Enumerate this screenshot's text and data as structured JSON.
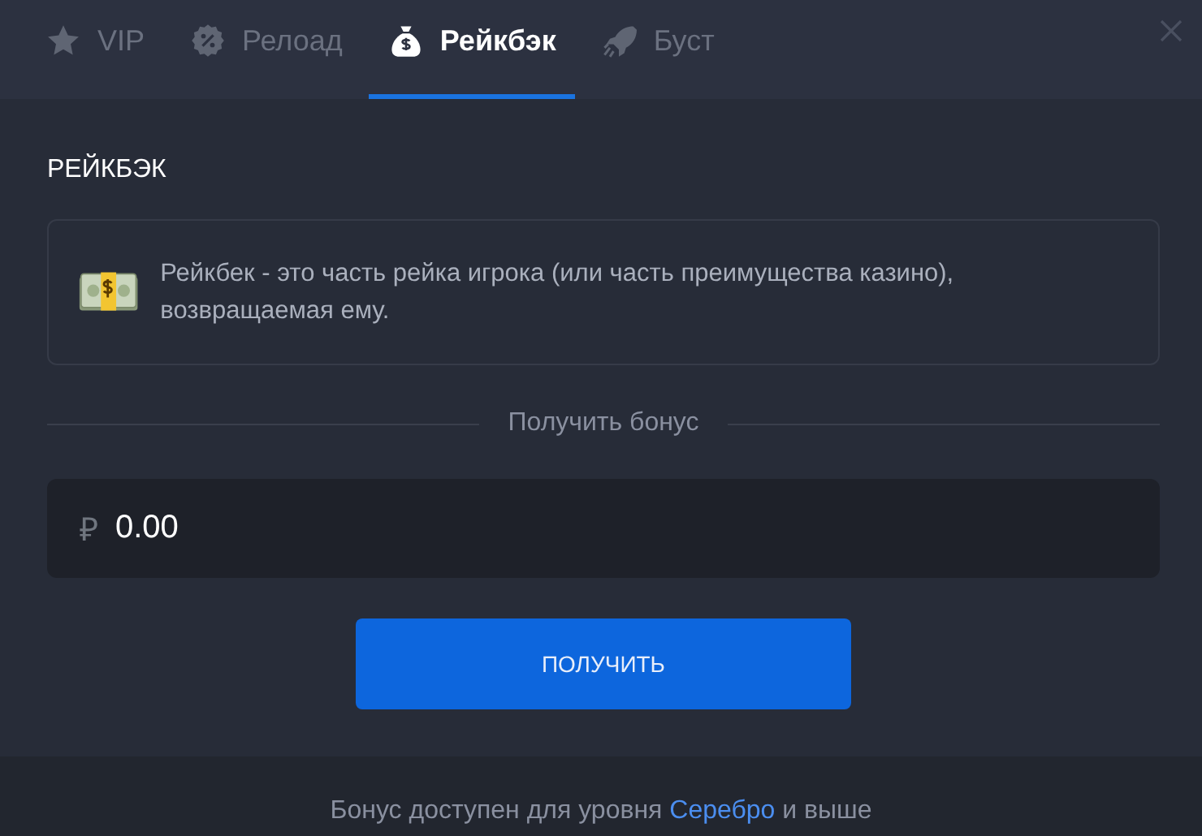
{
  "tabs": [
    {
      "label": "VIP",
      "kind": "star",
      "selected": false
    },
    {
      "label": "Релоад",
      "kind": "percent",
      "selected": false
    },
    {
      "label": "Рейкбэк",
      "kind": "moneybag",
      "selected": true
    },
    {
      "label": "Буст",
      "kind": "rocket",
      "selected": false
    }
  ],
  "section_title": "РЕЙКБЭК",
  "info": {
    "text": "Рейкбек - это часть рейка игрока (или часть преимущества казино), возвращаемая ему."
  },
  "divider_label": "Получить бонус",
  "amount": {
    "currency": "₽",
    "value": "0.00"
  },
  "button": "ПОЛУЧИТЬ",
  "footer": {
    "before": "Бонус доступен для уровня",
    "link": "Серебро",
    "after": "и выше"
  }
}
